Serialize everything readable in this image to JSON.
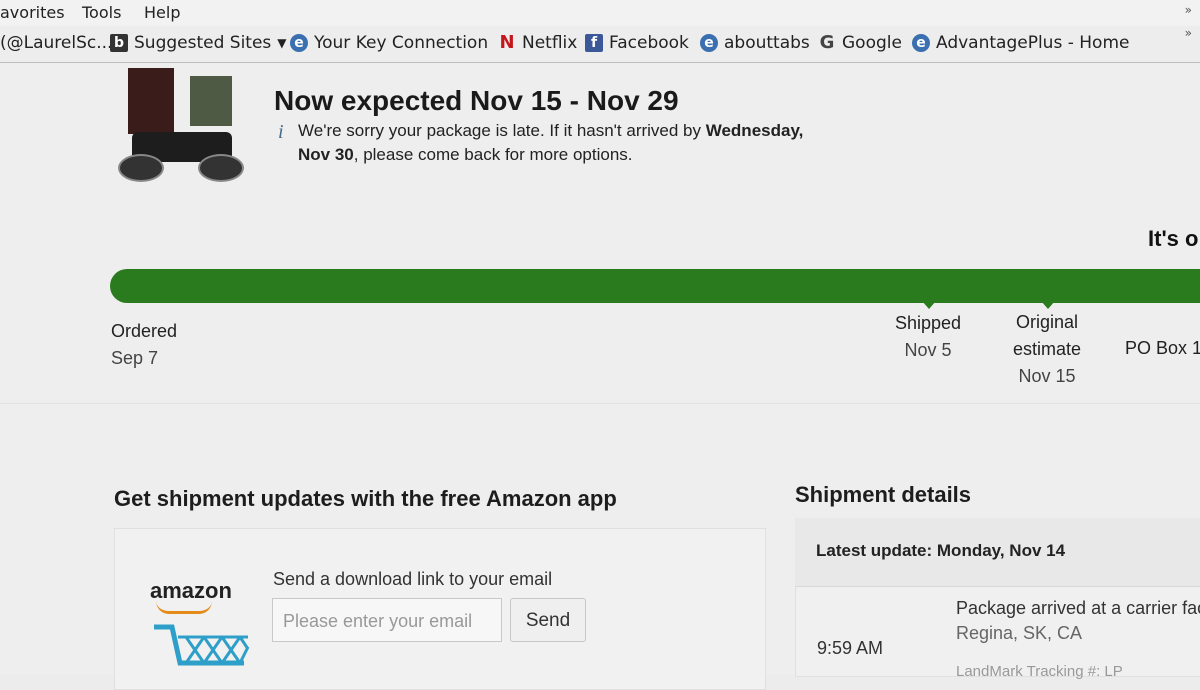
{
  "browser": {
    "menu": [
      "avorites",
      "Tools",
      "Help"
    ],
    "favorites": [
      {
        "label": "(@LaurelSc...",
        "icon": "bird-icon"
      },
      {
        "label": "Suggested Sites",
        "icon": "bing-icon"
      },
      {
        "label": "Your Key Connection",
        "icon": "ie-page-icon"
      },
      {
        "label": "Netflix",
        "icon": "netflix-icon"
      },
      {
        "label": "Facebook",
        "icon": "facebook-icon"
      },
      {
        "label": "abouttabs",
        "icon": "ie-page-icon"
      },
      {
        "label": "Google",
        "icon": "google-icon"
      },
      {
        "label": "AdvantagePlus - Home",
        "icon": "ie-page-icon"
      }
    ],
    "overflow": "»"
  },
  "order": {
    "headline": "Now expected Nov 15 - Nov 29",
    "info_icon": "i",
    "message_part1": "We're sorry your package is late. If it hasn't arrived by ",
    "message_bold": "Wednesday, Nov 30",
    "message_part2": ", please come back for more options.",
    "status_cut": "It's o"
  },
  "progress": {
    "fill_fraction": 1.0,
    "steps": [
      {
        "label": "Ordered",
        "date": "Sep 7"
      },
      {
        "label": "Shipped",
        "date": "Nov 5"
      },
      {
        "label": "Original",
        "label2": "estimate",
        "date": "Nov 15"
      },
      {
        "label": "PO Box 1"
      }
    ]
  },
  "app_promo": {
    "heading": "Get shipment updates with the free Amazon app",
    "logo_text": "amazon",
    "download_label": "Send a download link to your email",
    "email_placeholder": "Please enter your email",
    "send_button": "Send"
  },
  "shipment": {
    "heading": "Shipment details",
    "latest_update": "Latest update: Monday, Nov 14",
    "event_time": "9:59 AM",
    "event_text": "Package arrived at a carrier fac",
    "event_location": "Regina, SK, CA",
    "event_tracking": "LandMark Tracking #: LP"
  },
  "colors": {
    "progress_green": "#2a7a1e",
    "smile_orange": "#e48c1a",
    "cart_blue": "#2e9fc8"
  }
}
